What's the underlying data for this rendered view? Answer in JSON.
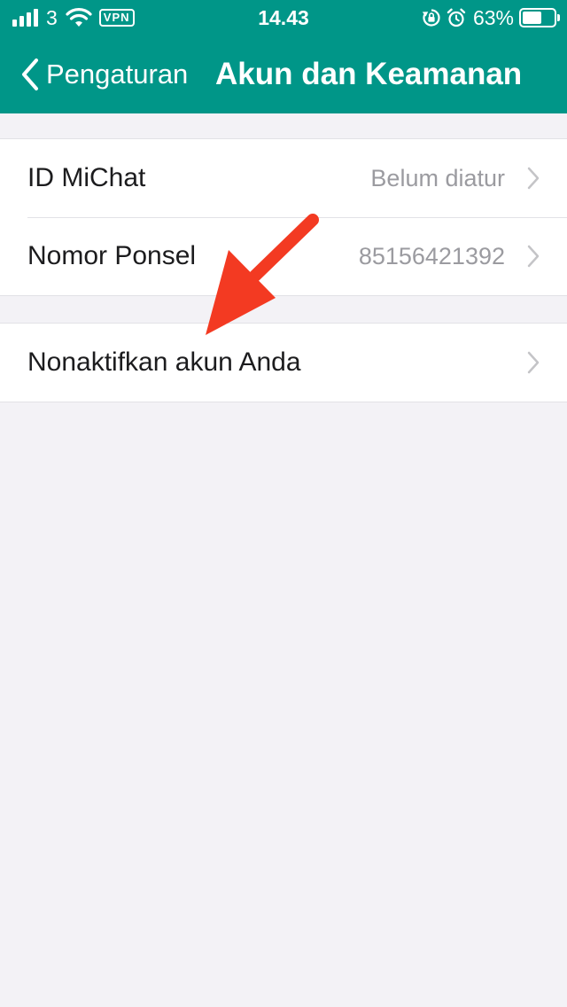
{
  "status_bar": {
    "carrier": "3",
    "vpn_label": "VPN",
    "time": "14.43",
    "battery_percent": "63%",
    "battery_level": 0.63
  },
  "nav": {
    "back_label": "Pengaturan",
    "title": "Akun dan Keamanan"
  },
  "settings": {
    "group1": [
      {
        "label": "ID MiChat",
        "value": "Belum diatur"
      },
      {
        "label": "Nomor Ponsel",
        "value": "85156421392"
      }
    ],
    "group2": [
      {
        "label": "Nonaktifkan akun Anda"
      }
    ]
  },
  "colors": {
    "header": "#009688",
    "background": "#f3f2f6",
    "annotation_arrow": "#f33a22"
  },
  "icons": [
    "signal-icon",
    "wifi-icon",
    "vpn-badge",
    "rotation-lock-icon",
    "alarm-icon",
    "battery-icon",
    "back-chevron-icon",
    "chevron-right-icon",
    "annotation-arrow"
  ]
}
